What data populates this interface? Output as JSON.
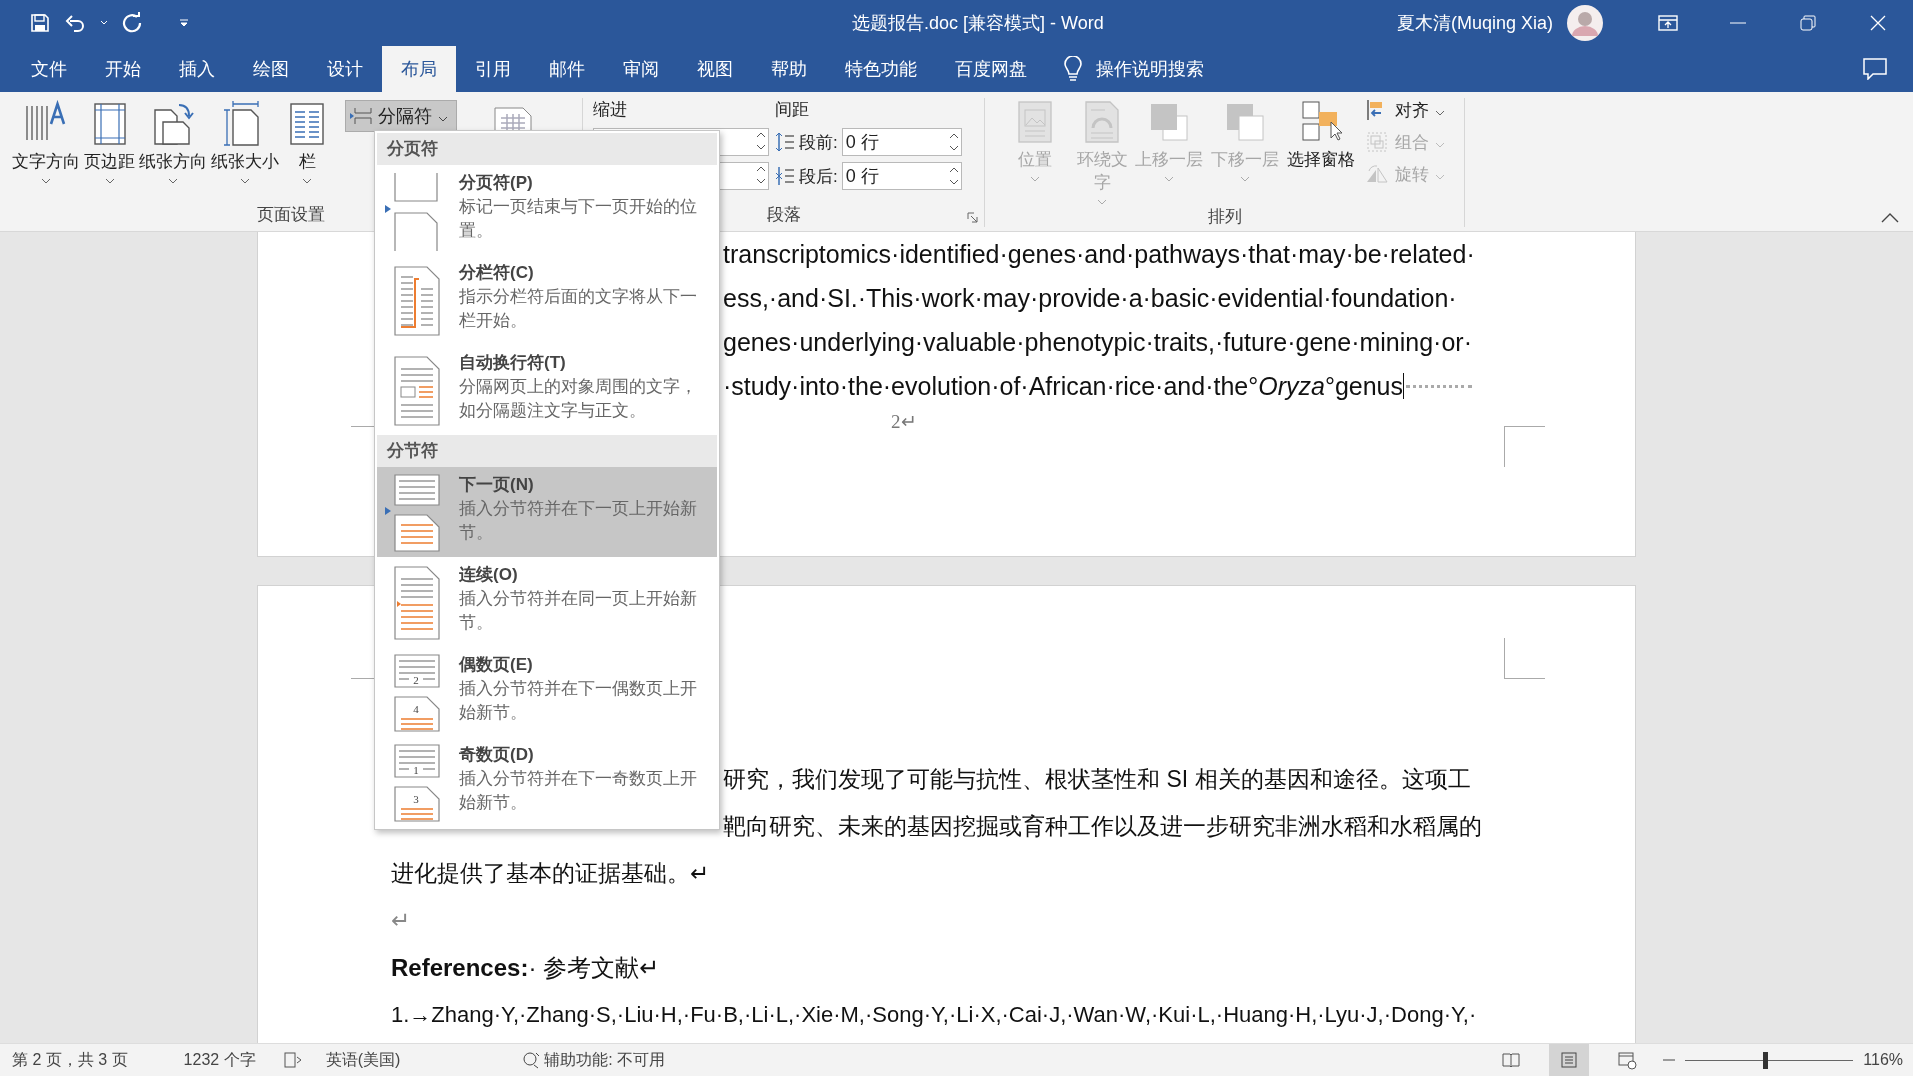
{
  "title_bar": {
    "document_title": "选题报告.doc [兼容模式]  -  Word",
    "user": "夏木清(Muqing Xia)"
  },
  "tabs": [
    {
      "label": "文件",
      "selected": false
    },
    {
      "label": "开始",
      "selected": false
    },
    {
      "label": "插入",
      "selected": false
    },
    {
      "label": "绘图",
      "selected": false
    },
    {
      "label": "设计",
      "selected": false
    },
    {
      "label": "布局",
      "selected": true
    },
    {
      "label": "引用",
      "selected": false
    },
    {
      "label": "邮件",
      "selected": false
    },
    {
      "label": "审阅",
      "selected": false
    },
    {
      "label": "视图",
      "selected": false
    },
    {
      "label": "帮助",
      "selected": false
    },
    {
      "label": "特色功能",
      "selected": false
    },
    {
      "label": "百度网盘",
      "selected": false
    }
  ],
  "tell_me": "操作说明搜索",
  "ribbon": {
    "page_setup": {
      "buttons": [
        {
          "label": "文字方向",
          "kind": "text-direction"
        },
        {
          "label": "页边距",
          "kind": "margins"
        },
        {
          "label": "纸张方向",
          "kind": "orientation"
        },
        {
          "label": "纸张大小",
          "kind": "size"
        },
        {
          "label": "栏",
          "kind": "columns"
        }
      ],
      "breaks_button": "分隔符",
      "label": "页面设置"
    },
    "paragraph": {
      "indent_label": "缩进",
      "spacing_label": "间距",
      "before": {
        "label": "段前:",
        "value": "0 行"
      },
      "after": {
        "label": "段后:",
        "value": "0 行"
      },
      "label": "段落"
    },
    "arrange": {
      "large": [
        {
          "label": "位置",
          "kind": "position",
          "disabled": true
        },
        {
          "label": "环绕文字",
          "kind": "wrap",
          "disabled": true
        },
        {
          "label": "上移一层",
          "kind": "forward",
          "disabled": true
        },
        {
          "label": "下移一层",
          "kind": "backward",
          "disabled": true
        },
        {
          "label": "选择窗格",
          "kind": "selection-pane",
          "disabled": false
        }
      ],
      "small": [
        {
          "label": "对齐",
          "kind": "align",
          "disabled": false
        },
        {
          "label": "组合",
          "kind": "group",
          "disabled": true
        },
        {
          "label": "旋转",
          "kind": "rotate",
          "disabled": true
        }
      ],
      "label": "排列"
    }
  },
  "breaks_menu": [
    {
      "heading": "分页符",
      "items": [
        {
          "kind": "page",
          "title": "分页符(P)",
          "description": "标记一页结束与下一页开始的位置。",
          "selected": false
        },
        {
          "kind": "column",
          "title": "分栏符(C)",
          "description": "指示分栏符后面的文字将从下一栏开始。",
          "selected": false
        },
        {
          "kind": "text-wrapping",
          "title": "自动换行符(T)",
          "description": "分隔网页上的对象周围的文字，如分隔题注文字与正文。",
          "selected": false
        }
      ]
    },
    {
      "heading": "分节符",
      "items": [
        {
          "kind": "next-page",
          "title": "下一页(N)",
          "description": "插入分节符并在下一页上开始新节。",
          "selected": true
        },
        {
          "kind": "continuous",
          "title": "连续(O)",
          "description": "插入分节符并在同一页上开始新节。",
          "selected": false
        },
        {
          "kind": "even-page",
          "title": "偶数页(E)",
          "description": "插入分节符并在下一偶数页上开始新节。",
          "icon_numbers": [
            "2",
            "4"
          ],
          "selected": false
        },
        {
          "kind": "odd-page",
          "title": "奇数页(D)",
          "description": "插入分节符并在下一奇数页上开始新节。",
          "icon_numbers": [
            "1",
            "3"
          ],
          "selected": false
        }
      ]
    }
  ],
  "page_1": {
    "lines": [
      "transcriptomics·identified·genes·and·pathways·that·may·be·related·",
      "ess,·and·SI.·This·work·may·provide·a·basic·evidential·foundation·",
      "genes·underlying·valuable·phenotypic·traits,·future·gene·mining·or·",
      "·study·into·the·evolution·of·African·rice·and·the°*Oryza*°genus"
    ],
    "page_number": "2↵"
  },
  "page_2": {
    "paragraph_lines": [
      "研究，我们发现了可能与抗性、根状茎性和 SI 相关的基因和途径。这项工",
      "靶向研究、未来的基因挖掘或育种工作以及进一步研究非洲水稻和水稻属的",
      "进化提供了基本的证据基础。↵"
    ],
    "empty_line": "↵",
    "heading": "**References:**· 参考文献↵",
    "reference": "1.→Zhang·Y,·Zhang·S,·Liu·H,·Fu·B,·Li·L,·Xie·M,·Song·Y,·Li·X,·Cai·J,·Wan·W,·Kui·L,·Huang·H,·Lyu·J,·Dong·Y,·"
  },
  "status_bar": {
    "page": "第 2 页，共 3 页",
    "words": "1232 个字",
    "language": "英语(美国)",
    "accessibility": "辅助功能: 不可用",
    "views": [
      {
        "kind": "read",
        "selected": false
      },
      {
        "kind": "print",
        "selected": true
      },
      {
        "kind": "web",
        "selected": false
      }
    ],
    "zoom": {
      "level": 0.46,
      "reading": "116%"
    }
  }
}
